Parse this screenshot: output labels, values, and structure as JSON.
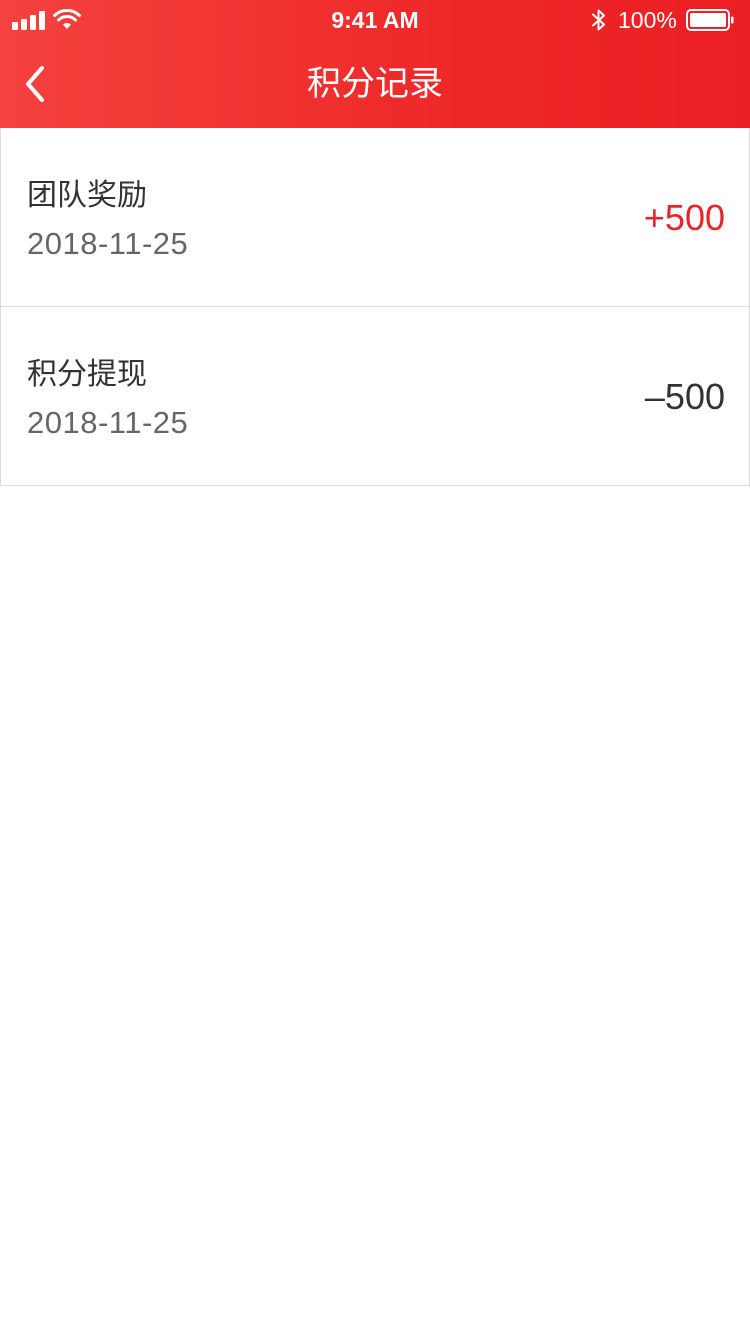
{
  "status_bar": {
    "time": "9:41 AM",
    "battery_percent": "100%",
    "battery_level": 1.0,
    "signal_icon": "signal-bars-icon",
    "wifi_icon": "wifi-icon",
    "bluetooth_icon": "bluetooth-icon",
    "battery_icon": "battery-icon"
  },
  "nav": {
    "title": "积分记录",
    "back_icon": "chevron-left-icon"
  },
  "records": [
    {
      "title": "团队奖励",
      "date": "2018-11-25",
      "amount": "+500",
      "type": "income"
    },
    {
      "title": "积分提现",
      "date": "2018-11-25",
      "amount": "–500",
      "type": "expense"
    }
  ],
  "colors": {
    "header_start": "#f5423e",
    "header_end": "#eb1e23",
    "income": "#e8232a",
    "expense": "#333333",
    "date": "#666666",
    "divider": "#dcdcdc"
  }
}
